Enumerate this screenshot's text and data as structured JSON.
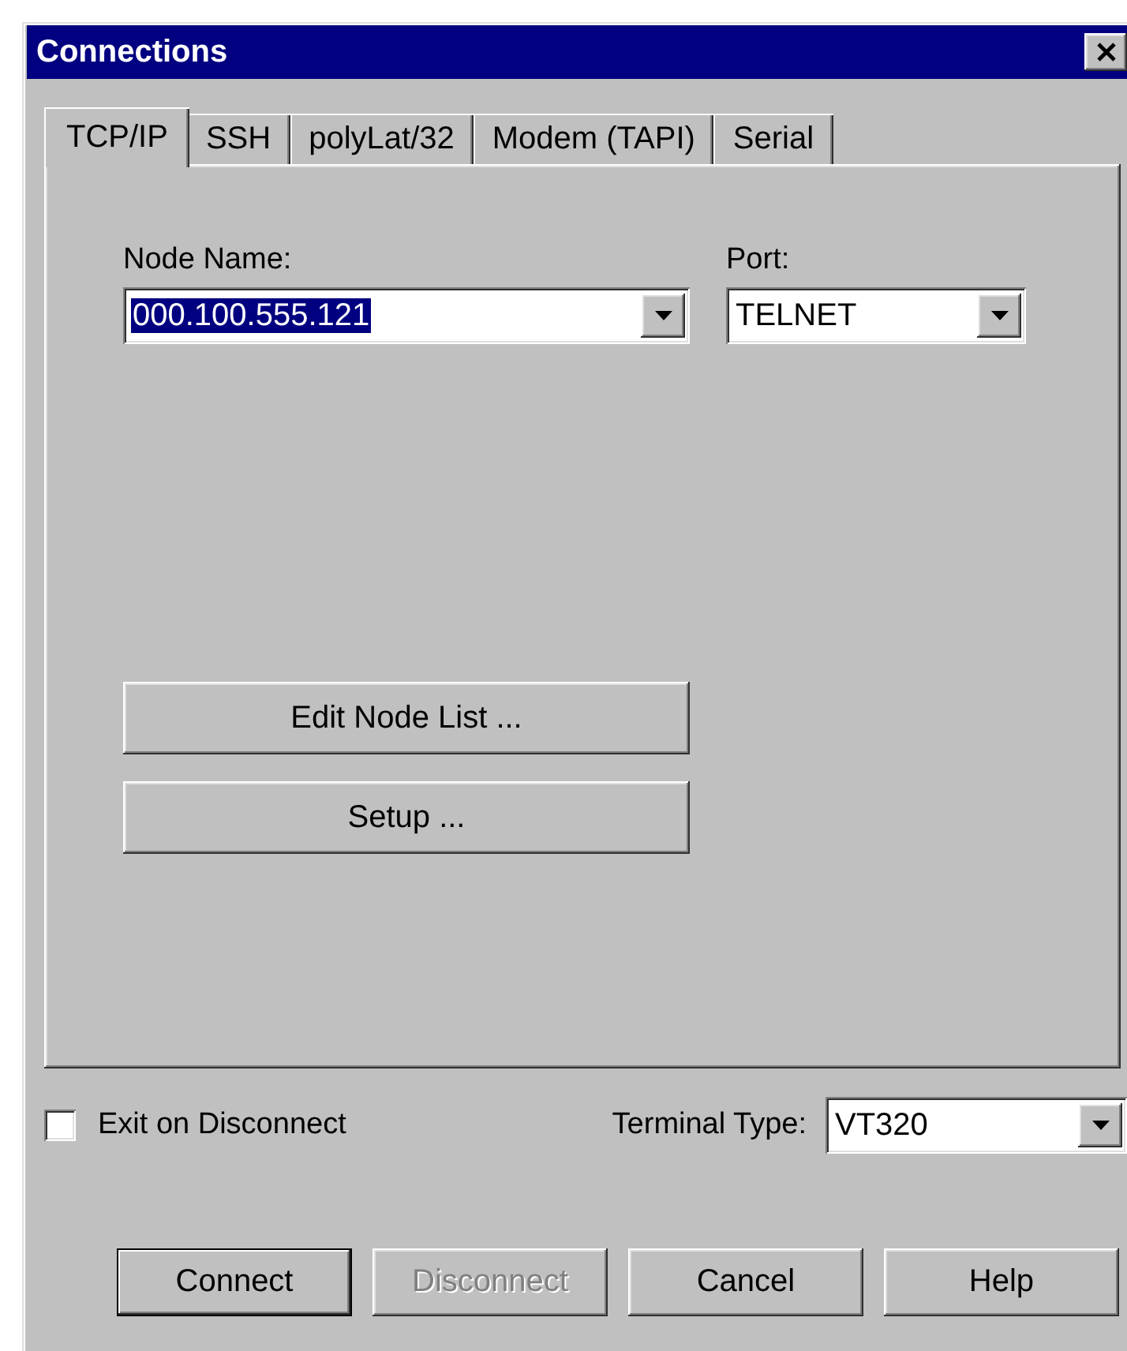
{
  "window": {
    "title": "Connections"
  },
  "tabs": [
    {
      "label": "TCP/IP",
      "selected": true
    },
    {
      "label": "SSH",
      "selected": false
    },
    {
      "label": "polyLat/32",
      "selected": false
    },
    {
      "label": "Modem (TAPI)",
      "selected": false
    },
    {
      "label": "Serial",
      "selected": false
    }
  ],
  "node_name": {
    "label": "Node Name:",
    "value": "000.100.555.121",
    "selected": true
  },
  "port": {
    "label": "Port:",
    "value": "TELNET",
    "selected": false
  },
  "panel_buttons": [
    "Edit Node List ...",
    "Setup ..."
  ],
  "exit_on_disconnect": {
    "label": "Exit on Disconnect",
    "checked": false
  },
  "terminal_type": {
    "label": "Terminal Type:",
    "value": "VT320",
    "selected": false
  },
  "buttons": [
    {
      "label": "Connect",
      "disabled": false,
      "default": true
    },
    {
      "label": "Disconnect",
      "disabled": true,
      "default": false
    },
    {
      "label": "Cancel",
      "disabled": false,
      "default": false
    },
    {
      "label": "Help",
      "disabled": false,
      "default": false
    }
  ]
}
